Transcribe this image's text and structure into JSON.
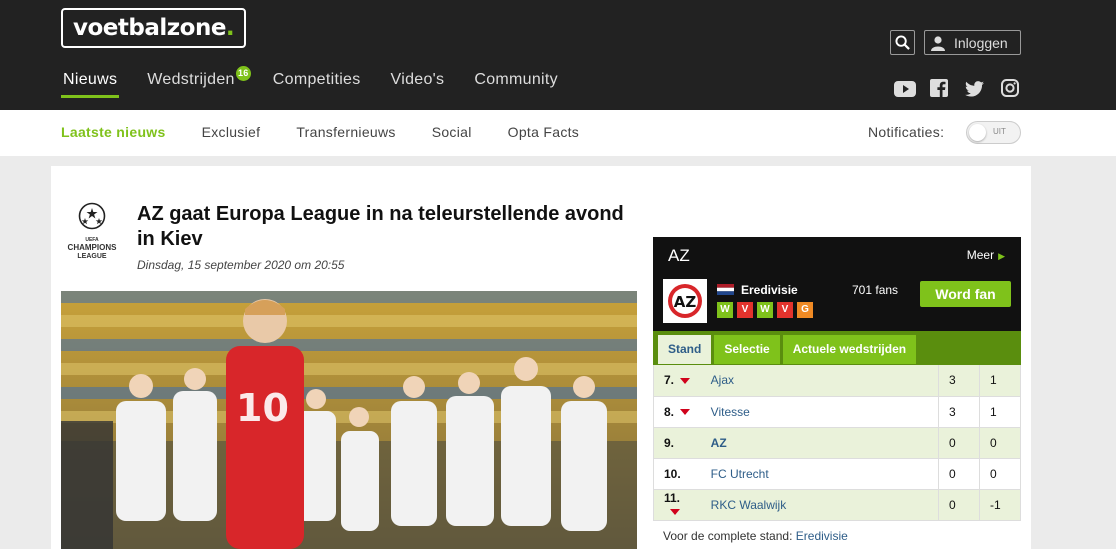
{
  "logo": {
    "text": "voetbalzone",
    "dot": "."
  },
  "main_nav": [
    {
      "label": "Nieuws",
      "active": true
    },
    {
      "label": "Wedstrijden",
      "badge": "16"
    },
    {
      "label": "Competities"
    },
    {
      "label": "Video's"
    },
    {
      "label": "Community"
    }
  ],
  "header": {
    "login_label": "Inloggen"
  },
  "social_icons": [
    "youtube-icon",
    "facebook-icon",
    "twitter-icon",
    "instagram-icon"
  ],
  "sub_nav": {
    "links": [
      "Laatste nieuws",
      "Exclusief",
      "Transfernieuws",
      "Social",
      "Opta Facts"
    ],
    "notifications_label": "Notificaties:",
    "toggle_label": "UIT"
  },
  "article": {
    "competition_logo_text": [
      "UEFA",
      "CHAMPIONS",
      "LEAGUE"
    ],
    "title": "AZ gaat Europa League in na teleurstellende avond in Kiev",
    "date": "Dinsdag, 15 september 2020 om 20:55"
  },
  "widget": {
    "club": "AZ",
    "more_label": "Meer",
    "competition": "Eredivisie",
    "fans": "701 fans",
    "fan_button": "Word fan",
    "form": [
      "W",
      "V",
      "W",
      "V",
      "G"
    ],
    "tabs": [
      "Stand",
      "Selectie",
      "Actuele wedstrijden"
    ],
    "standings": [
      {
        "pos": "7.",
        "team": "Ajax",
        "played": "3",
        "points": "1",
        "trend": "down"
      },
      {
        "pos": "8.",
        "team": "Vitesse",
        "played": "3",
        "points": "1",
        "trend": "down"
      },
      {
        "pos": "9.",
        "team": "AZ",
        "played": "0",
        "points": "0",
        "trend": "",
        "highlight": true
      },
      {
        "pos": "10.",
        "team": "FC Utrecht",
        "played": "0",
        "points": "0",
        "trend": ""
      },
      {
        "pos": "11.",
        "team": "RKC Waalwijk",
        "played": "0",
        "points": "-1",
        "trend": "down"
      }
    ],
    "footer_text": "Voor de complete stand:",
    "footer_link": "Eredivisie"
  },
  "colors": {
    "accent": "#7fc21b",
    "link": "#2e5d88",
    "header_bg": "#222222",
    "form_win": "#7fc21b",
    "form_loss": "#e3332d",
    "form_draw": "#f08a24"
  }
}
